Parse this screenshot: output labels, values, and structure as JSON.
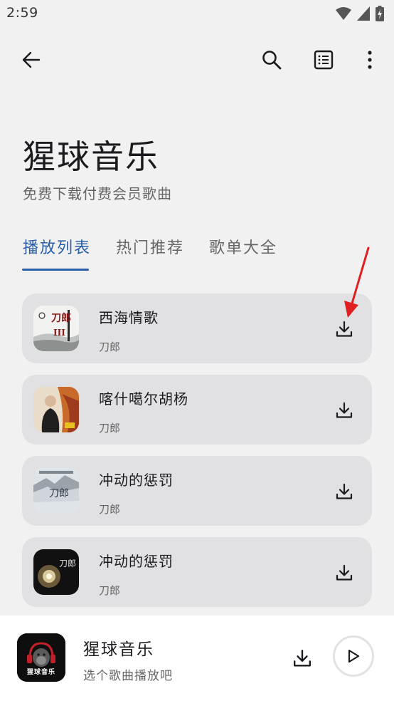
{
  "status_bar": {
    "time": "2:59",
    "icons": [
      "wifi-icon",
      "cellular-signal-icon",
      "battery-charging-icon"
    ]
  },
  "toolbar": {
    "icons": [
      "back-arrow-icon",
      "search-icon",
      "list-view-icon",
      "more-vertical-icon"
    ]
  },
  "header": {
    "title": "猩球音乐",
    "subtitle": "免费下载付费会员歌曲"
  },
  "tabs": [
    {
      "label": "播放列表",
      "active": true
    },
    {
      "label": "热门推荐",
      "active": false
    },
    {
      "label": "歌单大全",
      "active": false
    }
  ],
  "songs": [
    {
      "title": "西海情歌",
      "artist": "刀郎",
      "cover_text": "刀郎",
      "cover_sub": "III"
    },
    {
      "title": "喀什噶尔胡杨",
      "artist": "刀郎"
    },
    {
      "title": "冲动的惩罚",
      "artist": "刀郎",
      "cover_text": "刀郎"
    },
    {
      "title": "冲动的惩罚",
      "artist": "刀郎",
      "cover_text": "刀郎"
    }
  ],
  "player": {
    "logo_text": "猩球音乐",
    "title": "猩球音乐",
    "subtitle": "选个歌曲播放吧"
  },
  "colors": {
    "accent": "#2a5ea6",
    "card_background": "#e1e1e3",
    "page_background": "#f1f1f1",
    "annotation_arrow": "#e02020"
  }
}
